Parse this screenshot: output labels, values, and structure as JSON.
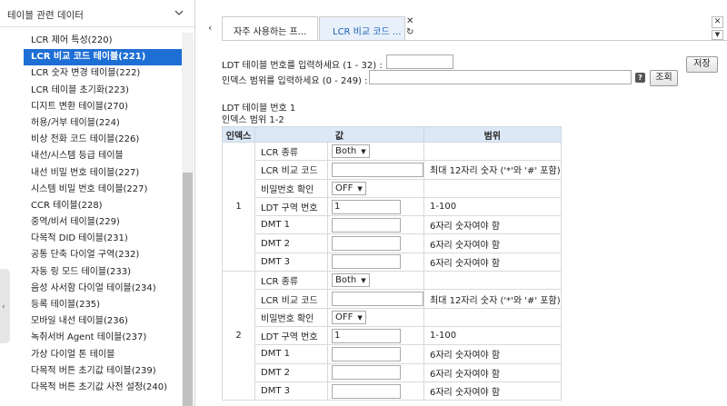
{
  "sidebar": {
    "title": "테이블 관련 데이터",
    "items": [
      {
        "label": "LCR 제어 특성(220)",
        "active": false
      },
      {
        "label": "LCR 비교 코드 테이블(221)",
        "active": true
      },
      {
        "label": "LCR 숫자 변경 테이블(222)",
        "active": false
      },
      {
        "label": "LCR 테이블 초기화(223)",
        "active": false
      },
      {
        "label": "디지트 변환 테이블(270)",
        "active": false
      },
      {
        "label": "허용/거부 테이블(224)",
        "active": false
      },
      {
        "label": "비상 전화 코드 테이블(226)",
        "active": false
      },
      {
        "label": "내선/시스템 등급 테이블",
        "active": false
      },
      {
        "label": "내선 비밀 번호 테이블(227)",
        "active": false
      },
      {
        "label": "시스템 비밀 번호 테이블(227)",
        "active": false
      },
      {
        "label": "CCR 테이블(228)",
        "active": false
      },
      {
        "label": "중역/비서 테이블(229)",
        "active": false
      },
      {
        "label": "다목적 DID 테이블(231)",
        "active": false
      },
      {
        "label": "공통 단축 다이얼 구역(232)",
        "active": false
      },
      {
        "label": "자동 링 모드 테이블(233)",
        "active": false
      },
      {
        "label": "음성 사서함 다이얼 테이블(234)",
        "active": false
      },
      {
        "label": "등록 테이블(235)",
        "active": false
      },
      {
        "label": "모바일 내선 테이블(236)",
        "active": false
      },
      {
        "label": "녹취서버 Agent 테이블(237)",
        "active": false
      },
      {
        "label": "가상 다이얼 톤 테이블",
        "active": false
      },
      {
        "label": "다목적 버튼 초기값 테이블(239)",
        "active": false
      },
      {
        "label": "다목적 버튼 초기값 사전 설정(240)",
        "active": false
      }
    ]
  },
  "tabs": [
    {
      "label": "자주 사용하는 프...",
      "active": false
    },
    {
      "label": "LCR 비교 코드 ...",
      "active": true
    }
  ],
  "form": {
    "ldt_label": "LDT 테이블 번호를 입력하세요 (1 - 32) :",
    "ldt_value": "",
    "index_label": "인덱스 범위를 입력하세요 (0 - 249) :",
    "index_value": "",
    "help_label": "?",
    "search_button": "조회",
    "save_button": "저장"
  },
  "info": {
    "ldt_line": "LDT 테이블 번호 1",
    "index_line": "인덱스 범위 1-2"
  },
  "table": {
    "headers": {
      "index": "인덱스",
      "value": "값",
      "range": "범위"
    },
    "groups": [
      {
        "index": "1",
        "rows": [
          {
            "name": "LCR 종류",
            "type": "select",
            "value": "Both",
            "range": ""
          },
          {
            "name": "LCR 비교 코드",
            "type": "input",
            "value": "",
            "range": "최대 12자리 숫자 ('*'와 '#' 포함)"
          },
          {
            "name": "비밀번호 확인",
            "type": "select",
            "value": "OFF",
            "range": ""
          },
          {
            "name": "LDT 구역 번호",
            "type": "input",
            "value": "1",
            "range": "1-100"
          },
          {
            "name": "DMT 1",
            "type": "input",
            "value": "",
            "range": "6자리 숫자여야 함"
          },
          {
            "name": "DMT 2",
            "type": "input",
            "value": "",
            "range": "6자리 숫자여야 함"
          },
          {
            "name": "DMT 3",
            "type": "input",
            "value": "",
            "range": "6자리 숫자여야 함"
          }
        ]
      },
      {
        "index": "2",
        "rows": [
          {
            "name": "LCR 종류",
            "type": "select",
            "value": "Both",
            "range": ""
          },
          {
            "name": "LCR 비교 코드",
            "type": "input",
            "value": "",
            "range": "최대 12자리 숫자 ('*'와 '#' 포함)"
          },
          {
            "name": "비밀번호 확인",
            "type": "select",
            "value": "OFF",
            "range": ""
          },
          {
            "name": "LDT 구역 번호",
            "type": "input",
            "value": "1",
            "range": "1-100"
          },
          {
            "name": "DMT 1",
            "type": "input",
            "value": "",
            "range": "6자리 숫자여야 함"
          },
          {
            "name": "DMT 2",
            "type": "input",
            "value": "",
            "range": "6자리 숫자여야 함"
          },
          {
            "name": "DMT 3",
            "type": "input",
            "value": "",
            "range": "6자리 숫자여야 함"
          }
        ]
      }
    ]
  }
}
